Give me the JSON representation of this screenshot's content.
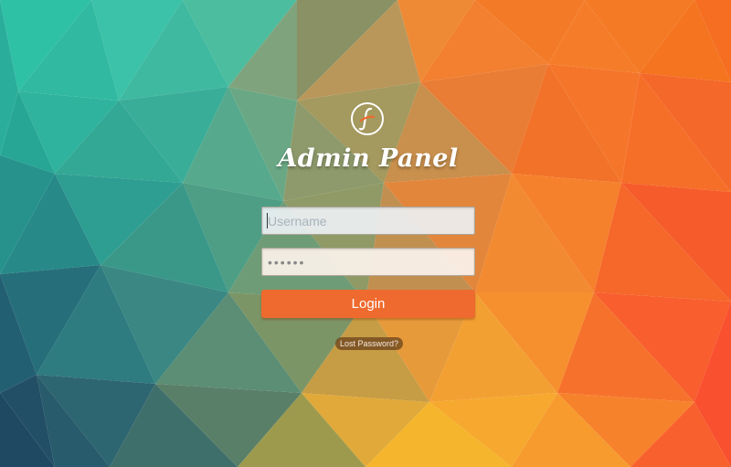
{
  "page": {
    "title": "Admin Panel"
  },
  "logo": {
    "icon": "script-f-icon",
    "letter": "f",
    "accent_color": "#ee6a2e"
  },
  "login_form": {
    "username_placeholder": "Username",
    "username_value": "",
    "password_value": "••••••",
    "login_label": "Login",
    "lost_password_label": "Lost Password?"
  },
  "colors": {
    "teal": "#2fbfa5",
    "orange": "#f26f22",
    "yellow": "#f3b22b",
    "button": "#ee6a2e"
  }
}
